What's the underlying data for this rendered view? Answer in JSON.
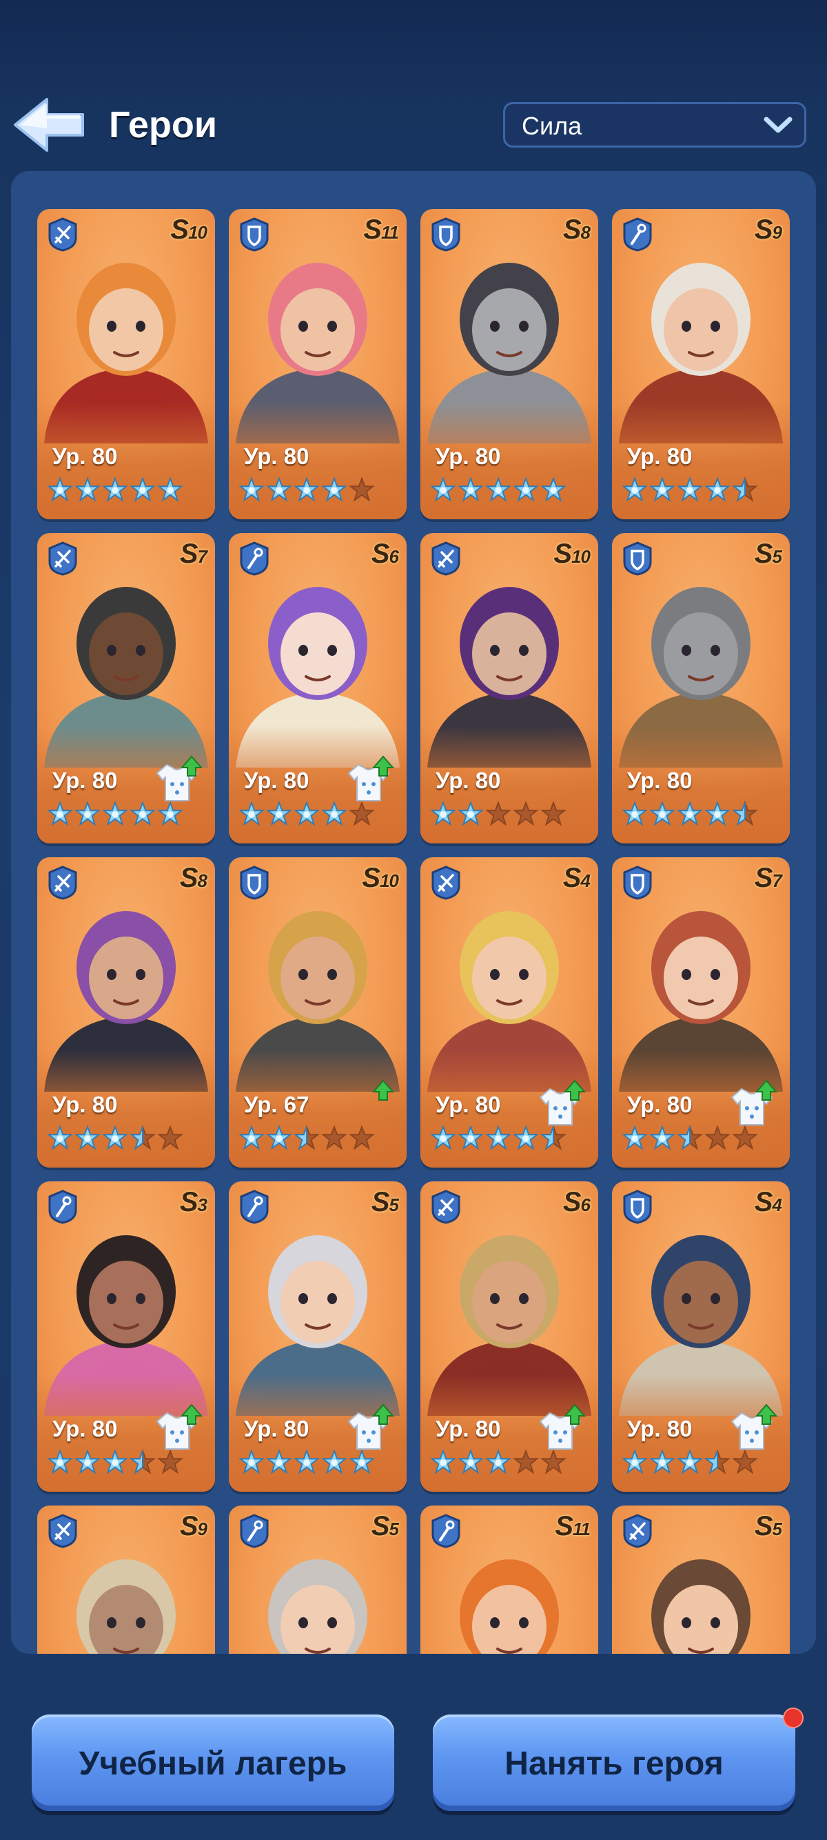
{
  "header": {
    "title": "Герои",
    "sort": {
      "selected": "Сила"
    }
  },
  "heroes": [
    {
      "cls": "crossbow",
      "rank": "S",
      "rank_num": "10",
      "level": "Ур. 80",
      "stars": 5,
      "gear": false,
      "hair": "#e88a3a",
      "hood": "#a82a24",
      "skin": "#f2c7a5"
    },
    {
      "cls": "shield",
      "rank": "S",
      "rank_num": "11",
      "level": "Ур. 80",
      "stars": 4,
      "gear": false,
      "hair": "#e87a88",
      "hood": "#5b5e70",
      "skin": "#f0c2a4"
    },
    {
      "cls": "shield",
      "rank": "S",
      "rank_num": "8",
      "level": "Ур. 80",
      "stars": 5,
      "gear": false,
      "hair": "#43414a",
      "hood": "#8d9197",
      "skin": "#a6a8ab"
    },
    {
      "cls": "staff",
      "rank": "S",
      "rank_num": "9",
      "level": "Ур. 80",
      "stars": 4.5,
      "gear": false,
      "hair": "#e9e2d8",
      "hood": "#9c3a27",
      "skin": "#efc4a8"
    },
    {
      "cls": "crossbow",
      "rank": "S",
      "rank_num": "7",
      "level": "Ур. 80",
      "stars": 5,
      "gear": true,
      "hair": "#3a3a3a",
      "hood": "#6d8c8c",
      "skin": "#6e4a34"
    },
    {
      "cls": "staff",
      "rank": "S",
      "rank_num": "6",
      "level": "Ур. 80",
      "stars": 4,
      "gear": true,
      "hair": "#8b5fc9",
      "hood": "#f1e6cf",
      "skin": "#f4dcd0"
    },
    {
      "cls": "crossbow",
      "rank": "S",
      "rank_num": "10",
      "level": "Ур. 80",
      "stars": 2,
      "gear": false,
      "hair": "#5a2f7a",
      "hood": "#3b3640",
      "skin": "#d9b29c"
    },
    {
      "cls": "shield",
      "rank": "S",
      "rank_num": "5",
      "level": "Ур. 80",
      "stars": 4.5,
      "gear": false,
      "hair": "#7a7c80",
      "hood": "#8b6a44",
      "skin": "#9a9ca0"
    },
    {
      "cls": "crossbow",
      "rank": "S",
      "rank_num": "8",
      "level": "Ур. 80",
      "stars": 3.5,
      "gear": false,
      "hair": "#8a4fa6",
      "hood": "#2d2f3c",
      "skin": "#d9a88a"
    },
    {
      "cls": "shield",
      "rank": "S",
      "rank_num": "10",
      "level": "Ур. 67",
      "stars": 2.5,
      "gear": "up",
      "hair": "#d6a24a",
      "hood": "#4a4a4a",
      "skin": "#e0aa86"
    },
    {
      "cls": "crossbow",
      "rank": "S",
      "rank_num": "4",
      "level": "Ур. 80",
      "stars": 4.5,
      "gear": true,
      "hair": "#e8c25a",
      "hood": "#a5463a",
      "skin": "#f2c8aa"
    },
    {
      "cls": "shield",
      "rank": "S",
      "rank_num": "7",
      "level": "Ур. 80",
      "stars": 2.5,
      "gear": true,
      "hair": "#b8553a",
      "hood": "#5a4434",
      "skin": "#f0c9ae"
    },
    {
      "cls": "staff",
      "rank": "S",
      "rank_num": "3",
      "level": "Ур. 80",
      "stars": 3.5,
      "gear": true,
      "hair": "#2e2424",
      "hood": "#d86aa6",
      "skin": "#a8705a"
    },
    {
      "cls": "staff",
      "rank": "S",
      "rank_num": "5",
      "level": "Ур. 80",
      "stars": 5,
      "gear": true,
      "hair": "#d6d6dc",
      "hood": "#4c6d8a",
      "skin": "#f1cdb4"
    },
    {
      "cls": "crossbow",
      "rank": "S",
      "rank_num": "6",
      "level": "Ур. 80",
      "stars": 3,
      "gear": true,
      "hair": "#c9a868",
      "hood": "#8a2e26",
      "skin": "#d9a47e"
    },
    {
      "cls": "shield",
      "rank": "S",
      "rank_num": "4",
      "level": "Ур. 80",
      "stars": 3.5,
      "gear": true,
      "hair": "#2f4468",
      "hood": "#cfc4b0",
      "skin": "#a06a4c"
    },
    {
      "cls": "crossbow",
      "rank": "S",
      "rank_num": "9",
      "level": "",
      "stars": 0,
      "gear": false,
      "hair": "#d8c8a8",
      "hood": "#8a6a54",
      "skin": "#b38a72"
    },
    {
      "cls": "staff",
      "rank": "S",
      "rank_num": "5",
      "level": "",
      "stars": 0,
      "gear": false,
      "hair": "#c9c4c0",
      "hood": "#8a6a54",
      "skin": "#f1cdb4"
    },
    {
      "cls": "staff",
      "rank": "S",
      "rank_num": "11",
      "level": "",
      "stars": 0,
      "gear": false,
      "hair": "#e6752e",
      "hood": "#c2552a",
      "skin": "#f2c2a0"
    },
    {
      "cls": "crossbow",
      "rank": "S",
      "rank_num": "5",
      "level": "",
      "stars": 0,
      "gear": false,
      "hair": "#6a4a36",
      "hood": "#7a5a46",
      "skin": "#f0c6a6"
    }
  ],
  "footer": {
    "training_camp": "Учебный лагерь",
    "hire_hero": "Нанять героя"
  },
  "colors": {
    "card": "#f39a52",
    "star_on": "#8fd3f2",
    "star_off": "#a9582c",
    "button": "#5d95f0"
  }
}
